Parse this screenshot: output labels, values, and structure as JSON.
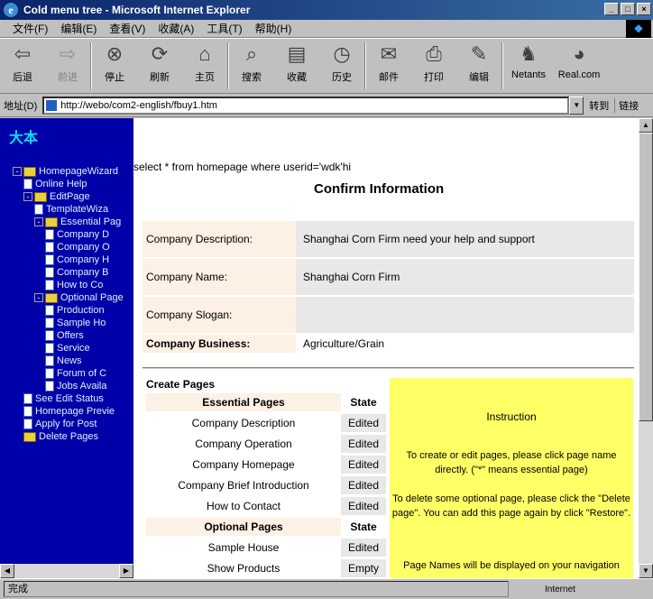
{
  "window": {
    "title": "Cold menu tree - Microsoft Internet Explorer"
  },
  "menu": [
    "文件(F)",
    "编辑(E)",
    "查看(V)",
    "收藏(A)",
    "工具(T)",
    "帮助(H)"
  ],
  "toolbar": [
    {
      "icon": "back-arrow-icon",
      "label": "后退",
      "disabled": false
    },
    {
      "icon": "forward-arrow-icon",
      "label": "前进",
      "disabled": true
    },
    {
      "icon": "stop-icon",
      "label": "停止",
      "disabled": false
    },
    {
      "icon": "refresh-icon",
      "label": "刷新",
      "disabled": false
    },
    {
      "icon": "home-icon",
      "label": "主页",
      "disabled": false
    },
    {
      "icon": "search-icon",
      "label": "搜索",
      "disabled": false
    },
    {
      "icon": "favorites-icon",
      "label": "收藏",
      "disabled": false
    },
    {
      "icon": "history-icon",
      "label": "历史",
      "disabled": false
    },
    {
      "icon": "mail-icon",
      "label": "邮件",
      "disabled": false
    },
    {
      "icon": "print-icon",
      "label": "打印",
      "disabled": false
    },
    {
      "icon": "edit-icon",
      "label": "编辑",
      "disabled": false
    },
    {
      "icon": "messenger-icon",
      "label": "Netants",
      "disabled": false
    },
    {
      "icon": "realcom-icon",
      "label": "Real.com",
      "disabled": false
    }
  ],
  "address": {
    "label": "地址(D)",
    "url": "http://webo/com2-english/fbuy1.htm",
    "go": "转到",
    "links": "链接"
  },
  "tree": {
    "header": "大本",
    "nodes": [
      {
        "label": "HomepageWizard",
        "type": "folder",
        "level": 0,
        "toggle": "-"
      },
      {
        "label": "Online Help",
        "type": "doc",
        "level": 1
      },
      {
        "label": "EditPage",
        "type": "folder",
        "level": 1,
        "toggle": "-"
      },
      {
        "label": "TemplateWiza",
        "type": "doc",
        "level": 2
      },
      {
        "label": "Essential Pag",
        "type": "folder",
        "level": 2,
        "toggle": "-"
      },
      {
        "label": "Company D",
        "type": "doc",
        "level": 3
      },
      {
        "label": "Company O",
        "type": "doc",
        "level": 3
      },
      {
        "label": "Company H",
        "type": "doc",
        "level": 3
      },
      {
        "label": "Company B",
        "type": "doc",
        "level": 3
      },
      {
        "label": "How to Co",
        "type": "doc",
        "level": 3
      },
      {
        "label": "Optional Page",
        "type": "folder",
        "level": 2,
        "toggle": "-"
      },
      {
        "label": "Production",
        "type": "doc",
        "level": 3
      },
      {
        "label": "Sample Ho",
        "type": "doc",
        "level": 3
      },
      {
        "label": "Offers",
        "type": "doc",
        "level": 3
      },
      {
        "label": "Service",
        "type": "doc",
        "level": 3
      },
      {
        "label": "News",
        "type": "doc",
        "level": 3
      },
      {
        "label": "Forum of C",
        "type": "doc",
        "level": 3
      },
      {
        "label": "Jobs Availa",
        "type": "doc",
        "level": 3
      },
      {
        "label": "See Edit Status",
        "type": "doc",
        "level": 1
      },
      {
        "label": "Homepage Previe",
        "type": "doc",
        "level": 1
      },
      {
        "label": "Apply for Post",
        "type": "doc",
        "level": 1
      },
      {
        "label": "Delete Pages",
        "type": "folder",
        "level": 1
      }
    ]
  },
  "content": {
    "sql": "select * from homepage where userid='wdk'hi",
    "confirm_title": "Confirm Information",
    "info": [
      {
        "label": "Company Description:",
        "value": "Shanghai Corn Firm need your help and support"
      },
      {
        "label": "Company Name:",
        "value": "Shanghai Corn Firm"
      },
      {
        "label": "Company Slogan:",
        "value": ""
      },
      {
        "label": "Company Business:",
        "value": "Agriculture/Grain"
      }
    ],
    "create_label": "Create Pages",
    "essential_header": "Essential Pages",
    "optional_header": "Optional Pages",
    "state_header": "State",
    "essential_pages": [
      {
        "name": "Company Description",
        "state": "Edited"
      },
      {
        "name": "Company Operation",
        "state": "Edited"
      },
      {
        "name": "Company Homepage",
        "state": "Edited"
      },
      {
        "name": "Company Brief Introduction",
        "state": "Edited"
      },
      {
        "name": "How to Contact",
        "state": "Edited"
      }
    ],
    "optional_pages": [
      {
        "name": "Sample House",
        "state": "Edited"
      },
      {
        "name": "Show Products",
        "state": "Empty"
      }
    ],
    "instruction": {
      "title": "Instruction",
      "p1": "To create or edit pages, please click page name directly. (\"*\" means essential page)",
      "p2": "To delete some optional page, please click the \"Delete page\". You can add this page again by click \"Restore\".",
      "p3": "Page Names will be displayed on your navigation"
    }
  },
  "status": {
    "text": "完成",
    "zone": "Internet"
  },
  "colors": {
    "tree_bg": "#0000a8",
    "label_bg": "#fdf0e4",
    "value_bg": "#e8e8e8",
    "instruction_bg": "#ffff66"
  }
}
